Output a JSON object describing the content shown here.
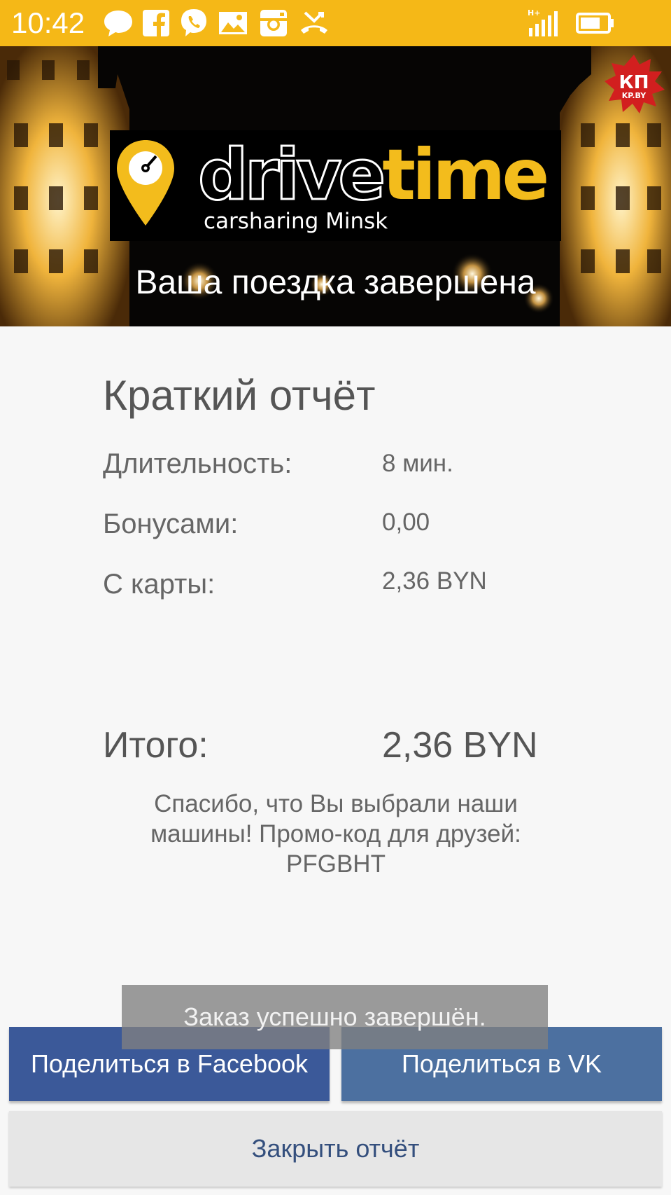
{
  "status_bar": {
    "time": "10:42",
    "notification_icons": [
      "chat-bubble-icon",
      "facebook-icon",
      "viber-icon",
      "image-icon",
      "instagram-icon",
      "missed-call-icon"
    ],
    "network": "H+",
    "background_color": "#f5b817"
  },
  "header": {
    "logo_drive": "drive",
    "logo_time": "time",
    "logo_subtitle": "carsharing Minsk",
    "title": "Ваша поездка завершена",
    "badge_text": "КП",
    "badge_subtext": "KP.BY",
    "accent_color": "#f3bc1c"
  },
  "report": {
    "title": "Краткий отчёт",
    "rows": [
      {
        "label": "Длительность:",
        "value": "8 мин."
      },
      {
        "label": "Бонусами:",
        "value": "0,00"
      },
      {
        "label": "С карты:",
        "value": "2,36 BYN"
      }
    ],
    "total_label": "Итого:",
    "total_value": "2,36 BYN",
    "thanks_text": "Спасибо, что Вы выбрали наши машины! Промо-код для друзей: PFGBHT"
  },
  "toast": {
    "text": "Заказ успешно завершён."
  },
  "buttons": {
    "share_facebook": "Поделиться в Facebook",
    "share_vk": "Поделиться в VK",
    "close_report": "Закрыть отчёт",
    "facebook_color": "#3b5999",
    "vk_color": "#4c70a0"
  }
}
